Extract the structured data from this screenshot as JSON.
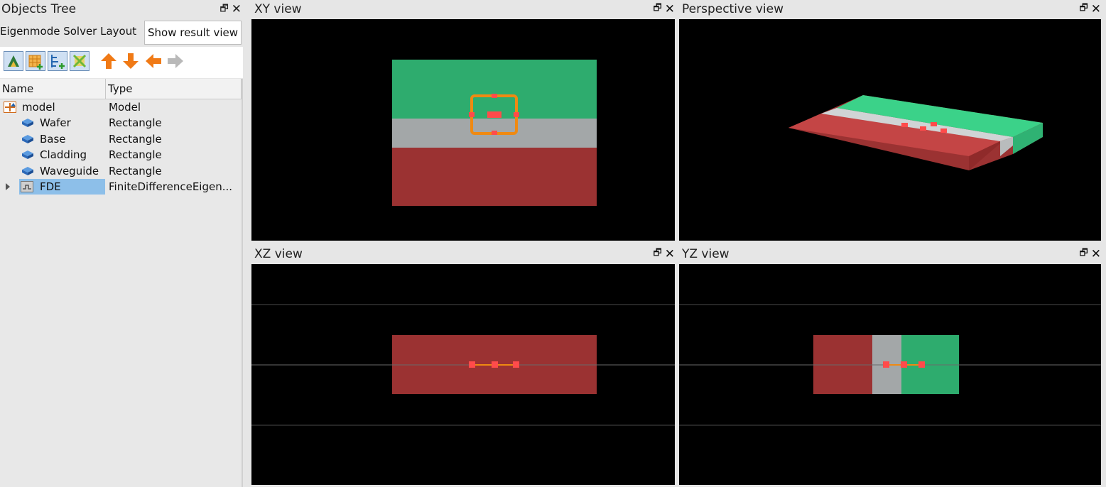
{
  "objects_tree": {
    "title": "Objects Tree",
    "layout_label": "Eigenmode Solver Layout",
    "show_result_button": "Show result view",
    "columns": {
      "name": "Name",
      "type": "Type"
    },
    "rows": [
      {
        "name": "model",
        "type": "Model",
        "icon": "model-icon"
      },
      {
        "name": "Wafer",
        "type": "Rectangle",
        "icon": "rectangle-icon"
      },
      {
        "name": "Base",
        "type": "Rectangle",
        "icon": "rectangle-icon"
      },
      {
        "name": "Cladding",
        "type": "Rectangle",
        "icon": "rectangle-icon"
      },
      {
        "name": "Waveguide",
        "type": "Rectangle",
        "icon": "rectangle-icon"
      },
      {
        "name": "FDE",
        "type": "FiniteDifferenceEigen...",
        "icon": "fde-solver-icon",
        "selected": true
      }
    ]
  },
  "toolbar": {
    "icons": [
      "select-object-icon",
      "add-mesh-icon",
      "add-port-icon",
      "delete-object-icon",
      "arrow-up-icon",
      "arrow-down-icon",
      "arrow-left-icon",
      "arrow-right-icon"
    ]
  },
  "views": {
    "xy": {
      "title": "XY view"
    },
    "perspective": {
      "title": "Perspective view"
    },
    "xz": {
      "title": "XZ view"
    },
    "yz": {
      "title": "YZ view"
    }
  },
  "window_buttons": {
    "float": "🗗",
    "close": "✕"
  },
  "colors": {
    "cladding": "#2eac6e",
    "waveguide": "#a3a7a8",
    "wafer": "#9b3232",
    "selection": "#ef8a12",
    "handle": "#ff4b4b",
    "canvas_bg": "#000000",
    "selected_row": "#8dbfe9"
  }
}
